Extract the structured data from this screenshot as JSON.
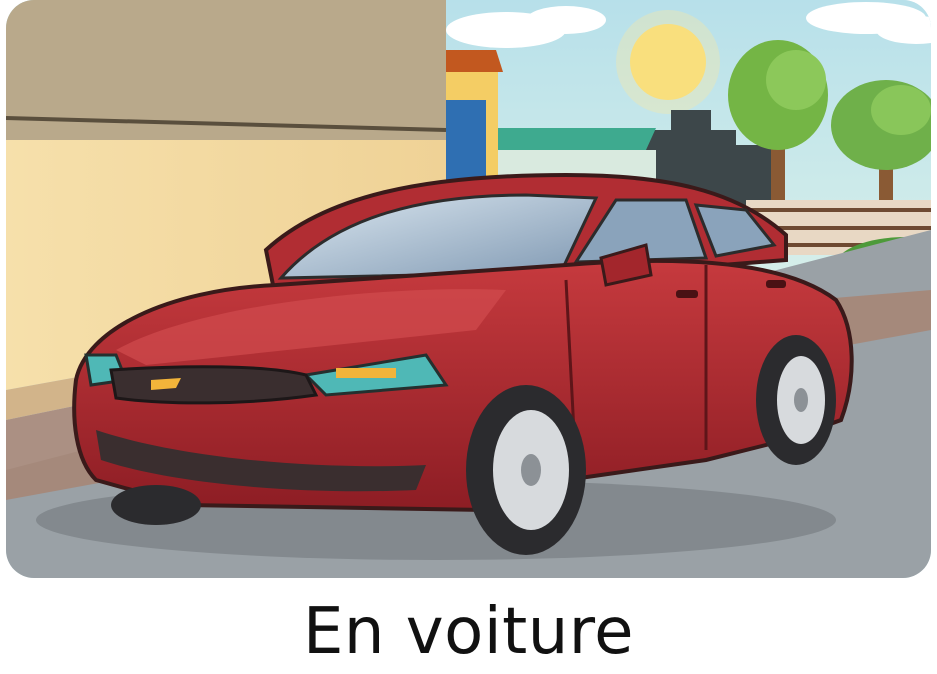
{
  "card": {
    "caption": "En voiture",
    "illustration_subject": "car-illustration"
  },
  "colors": {
    "car_body": "#a3262c",
    "sky": "#bfe3ea",
    "sun": "#f7d96a",
    "road": "#9aa1a6",
    "wall": "#f3dca4"
  }
}
